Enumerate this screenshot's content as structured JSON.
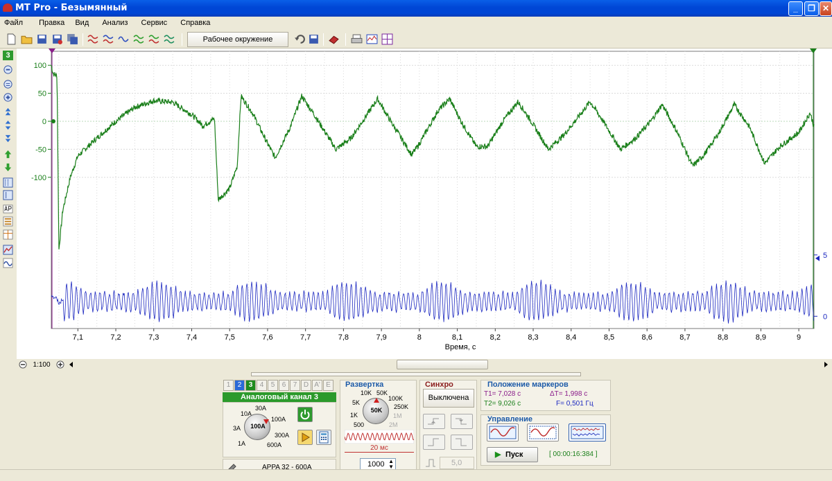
{
  "window": {
    "title": "MT Pro - Безымянный",
    "min": "_",
    "max": "❐",
    "close": "✕"
  },
  "menu": [
    "Файл",
    "Правка",
    "Вид",
    "Анализ",
    "Сервис",
    "Справка"
  ],
  "toolbar": {
    "workspace": "Рабочее окружение"
  },
  "left": {
    "channel_badge": "3"
  },
  "chart_data": {
    "type": "line",
    "xlabel": "Время, с",
    "xlim": [
      7.03,
      9.04
    ],
    "x_ticks": [
      "7,1",
      "7,2",
      "7,3",
      "7,4",
      "7,5",
      "7,6",
      "7,7",
      "7,8",
      "7,9",
      "8",
      "8,1",
      "8,2",
      "8,3",
      "8,4",
      "8,5",
      "8,6",
      "8,7",
      "8,8",
      "8,9",
      "9"
    ],
    "x_tick_values": [
      7.1,
      7.2,
      7.3,
      7.4,
      7.5,
      7.6,
      7.7,
      7.8,
      7.9,
      8.0,
      8.1,
      8.2,
      8.3,
      8.4,
      8.5,
      8.6,
      8.7,
      8.8,
      8.9,
      9.0
    ],
    "left_axis": {
      "ticks": [
        "100",
        "50",
        "0",
        "-50",
        "-100"
      ],
      "values": [
        100,
        50,
        0,
        -50,
        -100
      ],
      "ylim": [
        -370,
        125
      ]
    },
    "right_axis": {
      "ticks": [
        "5",
        "0"
      ],
      "values": [
        5,
        0
      ],
      "ylim": [
        -1,
        21.6
      ]
    },
    "grid": true,
    "series": [
      {
        "color": "#1a7f1a",
        "axis": "left",
        "points": [
          [
            7.03,
            100
          ],
          [
            7.035,
            85
          ],
          [
            7.04,
            83
          ],
          [
            7.045,
            82
          ],
          [
            7.05,
            -230
          ],
          [
            7.06,
            -160
          ],
          [
            7.08,
            -100
          ],
          [
            7.1,
            -62
          ],
          [
            7.15,
            -30
          ],
          [
            7.2,
            0
          ],
          [
            7.25,
            25
          ],
          [
            7.3,
            37
          ],
          [
            7.35,
            34
          ],
          [
            7.4,
            12
          ],
          [
            7.43,
            -8
          ],
          [
            7.46,
            5
          ],
          [
            7.47,
            -140
          ],
          [
            7.5,
            -120
          ],
          [
            7.52,
            -80
          ],
          [
            7.53,
            45
          ],
          [
            7.56,
            15
          ],
          [
            7.6,
            -40
          ],
          [
            7.62,
            -65
          ],
          [
            7.66,
            -10
          ],
          [
            7.69,
            45
          ],
          [
            7.72,
            15
          ],
          [
            7.78,
            -50
          ],
          [
            7.82,
            -30
          ],
          [
            7.85,
            0
          ],
          [
            7.89,
            40
          ],
          [
            7.92,
            5
          ],
          [
            7.98,
            -60
          ],
          [
            8.0,
            -40
          ],
          [
            8.05,
            20
          ],
          [
            8.08,
            40
          ],
          [
            8.11,
            0
          ],
          [
            8.15,
            -45
          ],
          [
            8.18,
            -45
          ],
          [
            8.22,
            0
          ],
          [
            8.26,
            35
          ],
          [
            8.29,
            5
          ],
          [
            8.34,
            -50
          ],
          [
            8.38,
            -25
          ],
          [
            8.41,
            0
          ],
          [
            8.45,
            35
          ],
          [
            8.48,
            5
          ],
          [
            8.53,
            -50
          ],
          [
            8.57,
            -30
          ],
          [
            8.61,
            0
          ],
          [
            8.64,
            30
          ],
          [
            8.68,
            -20
          ],
          [
            8.72,
            -80
          ],
          [
            8.75,
            -60
          ],
          [
            8.79,
            -20
          ],
          [
            8.83,
            30
          ],
          [
            8.87,
            -10
          ],
          [
            8.91,
            -75
          ],
          [
            8.95,
            -45
          ],
          [
            9.0,
            -20
          ],
          [
            9.03,
            15
          ],
          [
            9.04,
            -10
          ]
        ]
      },
      {
        "color": "#1c28c0",
        "axis": "right",
        "points": [
          [
            7.03,
            1.5
          ],
          [
            7.04,
            1.5
          ],
          [
            7.05,
            -1
          ],
          [
            7.06,
            1.2
          ],
          [
            9.04,
            1.2
          ]
        ],
        "oscillation": {
          "period": 0.0125,
          "envelope_max": 1.6
        }
      }
    ]
  },
  "zoom": {
    "label": "1:100"
  },
  "channel": {
    "tabs": [
      "1",
      "2",
      "3",
      "4",
      "5",
      "6",
      "7",
      "D",
      "A'",
      "E"
    ],
    "active_tab": "3",
    "title": "Аналоговый канал 3",
    "knob_center": "100A",
    "knob_labels": [
      "30A",
      "10A",
      "100A",
      "3A",
      "300A",
      "1A",
      "600A"
    ],
    "probe": "APPA 32 - 600A"
  },
  "sweep": {
    "title": "Развертка",
    "knob_center": "50K",
    "knob_labels": [
      "10K",
      "50K",
      "5K",
      "100K",
      "250K",
      "1K",
      "1M",
      "500",
      "2M"
    ],
    "time_label": "20 мс",
    "value": "1000"
  },
  "sync": {
    "title": "Синхро",
    "state": "Выключена",
    "level": "5,0"
  },
  "markers": {
    "title": "Положение маркеров",
    "t1": "T1= 7,028 с",
    "t2": "T2= 9,026 с",
    "dt": "ΔT= 1,998 с",
    "f": "F= 0,501 Гц"
  },
  "control": {
    "title": "Управление",
    "start": "Пуск",
    "elapsed": "[ 00:00:16:384 ]"
  },
  "colors": {
    "green": "#1a7f1a",
    "blue": "#1c28c0",
    "title_blue": "#0046d5"
  }
}
